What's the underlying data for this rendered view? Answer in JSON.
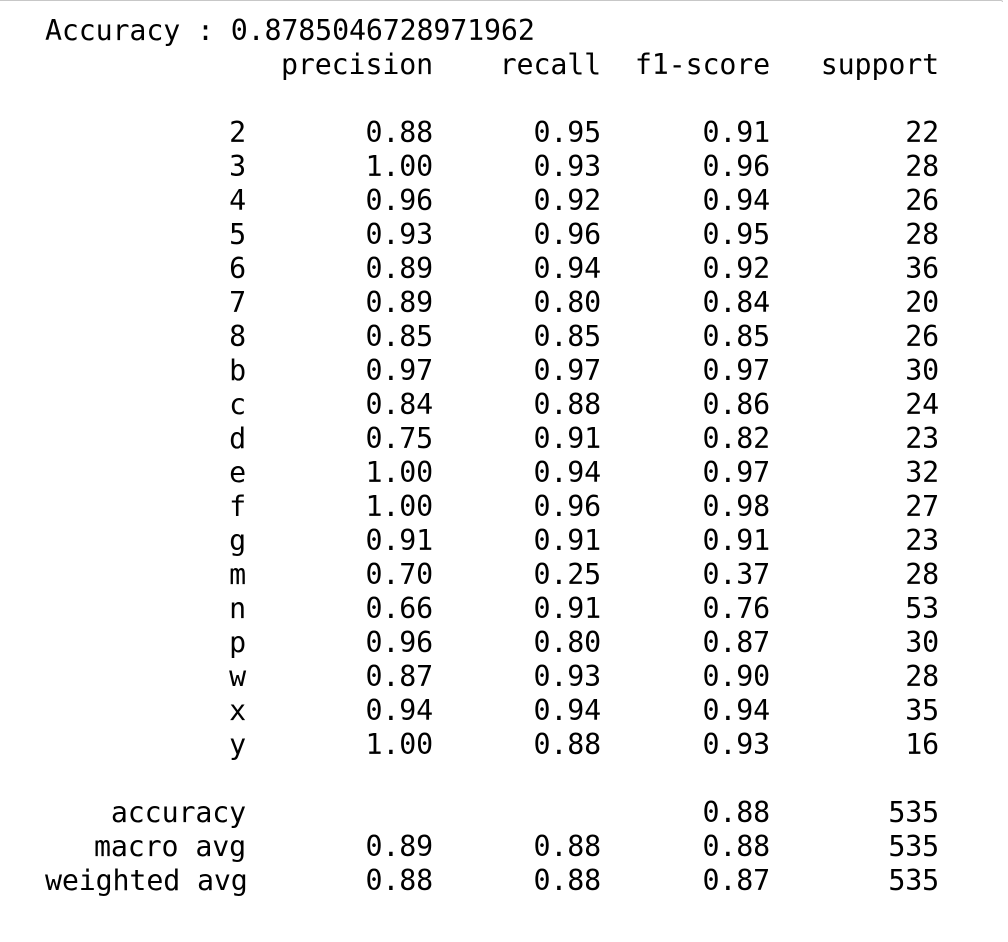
{
  "accuracy_line": "Accuracy : 0.8785046728971962",
  "report": {
    "headers": [
      "precision",
      "recall",
      "f1-score",
      "support"
    ],
    "rows": [
      {
        "label": "2",
        "precision": "0.88",
        "recall": "0.95",
        "f1": "0.91",
        "support": "22"
      },
      {
        "label": "3",
        "precision": "1.00",
        "recall": "0.93",
        "f1": "0.96",
        "support": "28"
      },
      {
        "label": "4",
        "precision": "0.96",
        "recall": "0.92",
        "f1": "0.94",
        "support": "26"
      },
      {
        "label": "5",
        "precision": "0.93",
        "recall": "0.96",
        "f1": "0.95",
        "support": "28"
      },
      {
        "label": "6",
        "precision": "0.89",
        "recall": "0.94",
        "f1": "0.92",
        "support": "36"
      },
      {
        "label": "7",
        "precision": "0.89",
        "recall": "0.80",
        "f1": "0.84",
        "support": "20"
      },
      {
        "label": "8",
        "precision": "0.85",
        "recall": "0.85",
        "f1": "0.85",
        "support": "26"
      },
      {
        "label": "b",
        "precision": "0.97",
        "recall": "0.97",
        "f1": "0.97",
        "support": "30"
      },
      {
        "label": "c",
        "precision": "0.84",
        "recall": "0.88",
        "f1": "0.86",
        "support": "24"
      },
      {
        "label": "d",
        "precision": "0.75",
        "recall": "0.91",
        "f1": "0.82",
        "support": "23"
      },
      {
        "label": "e",
        "precision": "1.00",
        "recall": "0.94",
        "f1": "0.97",
        "support": "32"
      },
      {
        "label": "f",
        "precision": "1.00",
        "recall": "0.96",
        "f1": "0.98",
        "support": "27"
      },
      {
        "label": "g",
        "precision": "0.91",
        "recall": "0.91",
        "f1": "0.91",
        "support": "23"
      },
      {
        "label": "m",
        "precision": "0.70",
        "recall": "0.25",
        "f1": "0.37",
        "support": "28"
      },
      {
        "label": "n",
        "precision": "0.66",
        "recall": "0.91",
        "f1": "0.76",
        "support": "53"
      },
      {
        "label": "p",
        "precision": "0.96",
        "recall": "0.80",
        "f1": "0.87",
        "support": "30"
      },
      {
        "label": "w",
        "precision": "0.87",
        "recall": "0.93",
        "f1": "0.90",
        "support": "28"
      },
      {
        "label": "x",
        "precision": "0.94",
        "recall": "0.94",
        "f1": "0.94",
        "support": "35"
      },
      {
        "label": "y",
        "precision": "1.00",
        "recall": "0.88",
        "f1": "0.93",
        "support": "16"
      }
    ],
    "summary": [
      {
        "label": "accuracy",
        "precision": "",
        "recall": "",
        "f1": "0.88",
        "support": "535"
      },
      {
        "label": "macro avg",
        "precision": "0.89",
        "recall": "0.88",
        "f1": "0.88",
        "support": "535"
      },
      {
        "label": "weighted avg",
        "precision": "0.88",
        "recall": "0.88",
        "f1": "0.87",
        "support": "535"
      }
    ]
  }
}
